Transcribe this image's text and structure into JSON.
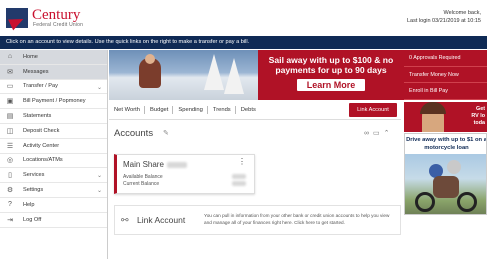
{
  "brand": {
    "name": "Century",
    "subtitle": "Federal Credit Union"
  },
  "welcome": {
    "line1": "Welcome back,",
    "line2": "Last login 03/21/2019 at 10:15"
  },
  "info_bar": "Click on an account to view details. Use the quick links on the right to make a transfer or pay a bill.",
  "sidebar": {
    "items": [
      {
        "label": "Home",
        "icon": "home-icon"
      },
      {
        "label": "Messages",
        "icon": "mail-icon"
      },
      {
        "label": "Transfer / Pay",
        "icon": "transfer-icon"
      },
      {
        "label": "Bill Payment / Popmoney",
        "icon": "bill-icon"
      },
      {
        "label": "Statements",
        "icon": "statement-icon"
      },
      {
        "label": "Deposit Check",
        "icon": "camera-icon"
      },
      {
        "label": "Activity Center",
        "icon": "list-icon"
      },
      {
        "label": "Locations/ATMs",
        "icon": "location-icon"
      },
      {
        "label": "Services",
        "icon": "services-icon"
      },
      {
        "label": "Settings",
        "icon": "gear-icon"
      },
      {
        "label": "Help",
        "icon": "help-icon"
      },
      {
        "label": "Log Off",
        "icon": "logout-icon"
      }
    ]
  },
  "banner": {
    "headline": "Sail away with up to $100 & no payments for up to 90 days",
    "button": "Learn More"
  },
  "quick_links": [
    "0 Approvals Required",
    "Transfer Money Now",
    "Enroll in Bill Pay"
  ],
  "tabs": [
    "Net Worth",
    "Budget",
    "Spending",
    "Trends",
    "Debts"
  ],
  "link_account_button": "Link Account",
  "accounts": {
    "title": "Accounts",
    "card": {
      "name": "Main Share",
      "available_label": "Available Balance",
      "current_label": "Current Balance"
    }
  },
  "link_account": {
    "title": "Link Account",
    "description": "You can pull in information from your other bank or credit union accounts to help you view and manage all of your finances right here. Click here to get started."
  },
  "side_ads": {
    "ad1_text": "Get RV lo toda",
    "ad2_text": "Drive away with up to $1 on a motorcycle loan"
  },
  "colors": {
    "brand_red": "#b01226",
    "navy": "#0f2a55"
  }
}
